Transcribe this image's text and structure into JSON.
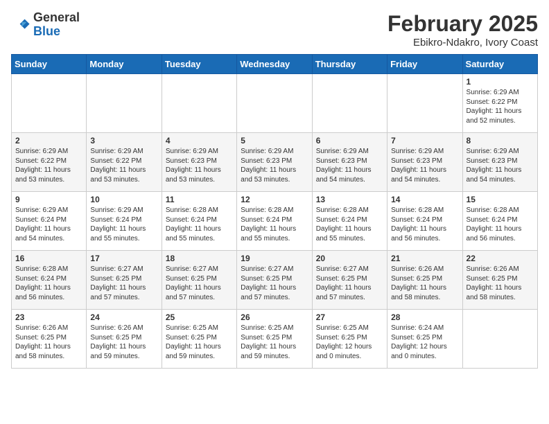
{
  "header": {
    "logo_line1": "General",
    "logo_line2": "Blue",
    "month_title": "February 2025",
    "location": "Ebikro-Ndakro, Ivory Coast"
  },
  "weekdays": [
    "Sunday",
    "Monday",
    "Tuesday",
    "Wednesday",
    "Thursday",
    "Friday",
    "Saturday"
  ],
  "weeks": [
    [
      {
        "day": "",
        "info": ""
      },
      {
        "day": "",
        "info": ""
      },
      {
        "day": "",
        "info": ""
      },
      {
        "day": "",
        "info": ""
      },
      {
        "day": "",
        "info": ""
      },
      {
        "day": "",
        "info": ""
      },
      {
        "day": "1",
        "info": "Sunrise: 6:29 AM\nSunset: 6:22 PM\nDaylight: 11 hours and 52 minutes."
      }
    ],
    [
      {
        "day": "2",
        "info": "Sunrise: 6:29 AM\nSunset: 6:22 PM\nDaylight: 11 hours and 53 minutes."
      },
      {
        "day": "3",
        "info": "Sunrise: 6:29 AM\nSunset: 6:22 PM\nDaylight: 11 hours and 53 minutes."
      },
      {
        "day": "4",
        "info": "Sunrise: 6:29 AM\nSunset: 6:23 PM\nDaylight: 11 hours and 53 minutes."
      },
      {
        "day": "5",
        "info": "Sunrise: 6:29 AM\nSunset: 6:23 PM\nDaylight: 11 hours and 53 minutes."
      },
      {
        "day": "6",
        "info": "Sunrise: 6:29 AM\nSunset: 6:23 PM\nDaylight: 11 hours and 54 minutes."
      },
      {
        "day": "7",
        "info": "Sunrise: 6:29 AM\nSunset: 6:23 PM\nDaylight: 11 hours and 54 minutes."
      },
      {
        "day": "8",
        "info": "Sunrise: 6:29 AM\nSunset: 6:23 PM\nDaylight: 11 hours and 54 minutes."
      }
    ],
    [
      {
        "day": "9",
        "info": "Sunrise: 6:29 AM\nSunset: 6:24 PM\nDaylight: 11 hours and 54 minutes."
      },
      {
        "day": "10",
        "info": "Sunrise: 6:29 AM\nSunset: 6:24 PM\nDaylight: 11 hours and 55 minutes."
      },
      {
        "day": "11",
        "info": "Sunrise: 6:28 AM\nSunset: 6:24 PM\nDaylight: 11 hours and 55 minutes."
      },
      {
        "day": "12",
        "info": "Sunrise: 6:28 AM\nSunset: 6:24 PM\nDaylight: 11 hours and 55 minutes."
      },
      {
        "day": "13",
        "info": "Sunrise: 6:28 AM\nSunset: 6:24 PM\nDaylight: 11 hours and 55 minutes."
      },
      {
        "day": "14",
        "info": "Sunrise: 6:28 AM\nSunset: 6:24 PM\nDaylight: 11 hours and 56 minutes."
      },
      {
        "day": "15",
        "info": "Sunrise: 6:28 AM\nSunset: 6:24 PM\nDaylight: 11 hours and 56 minutes."
      }
    ],
    [
      {
        "day": "16",
        "info": "Sunrise: 6:28 AM\nSunset: 6:24 PM\nDaylight: 11 hours and 56 minutes."
      },
      {
        "day": "17",
        "info": "Sunrise: 6:27 AM\nSunset: 6:25 PM\nDaylight: 11 hours and 57 minutes."
      },
      {
        "day": "18",
        "info": "Sunrise: 6:27 AM\nSunset: 6:25 PM\nDaylight: 11 hours and 57 minutes."
      },
      {
        "day": "19",
        "info": "Sunrise: 6:27 AM\nSunset: 6:25 PM\nDaylight: 11 hours and 57 minutes."
      },
      {
        "day": "20",
        "info": "Sunrise: 6:27 AM\nSunset: 6:25 PM\nDaylight: 11 hours and 57 minutes."
      },
      {
        "day": "21",
        "info": "Sunrise: 6:26 AM\nSunset: 6:25 PM\nDaylight: 11 hours and 58 minutes."
      },
      {
        "day": "22",
        "info": "Sunrise: 6:26 AM\nSunset: 6:25 PM\nDaylight: 11 hours and 58 minutes."
      }
    ],
    [
      {
        "day": "23",
        "info": "Sunrise: 6:26 AM\nSunset: 6:25 PM\nDaylight: 11 hours and 58 minutes."
      },
      {
        "day": "24",
        "info": "Sunrise: 6:26 AM\nSunset: 6:25 PM\nDaylight: 11 hours and 59 minutes."
      },
      {
        "day": "25",
        "info": "Sunrise: 6:25 AM\nSunset: 6:25 PM\nDaylight: 11 hours and 59 minutes."
      },
      {
        "day": "26",
        "info": "Sunrise: 6:25 AM\nSunset: 6:25 PM\nDaylight: 11 hours and 59 minutes."
      },
      {
        "day": "27",
        "info": "Sunrise: 6:25 AM\nSunset: 6:25 PM\nDaylight: 12 hours and 0 minutes."
      },
      {
        "day": "28",
        "info": "Sunrise: 6:24 AM\nSunset: 6:25 PM\nDaylight: 12 hours and 0 minutes."
      },
      {
        "day": "",
        "info": ""
      }
    ]
  ]
}
